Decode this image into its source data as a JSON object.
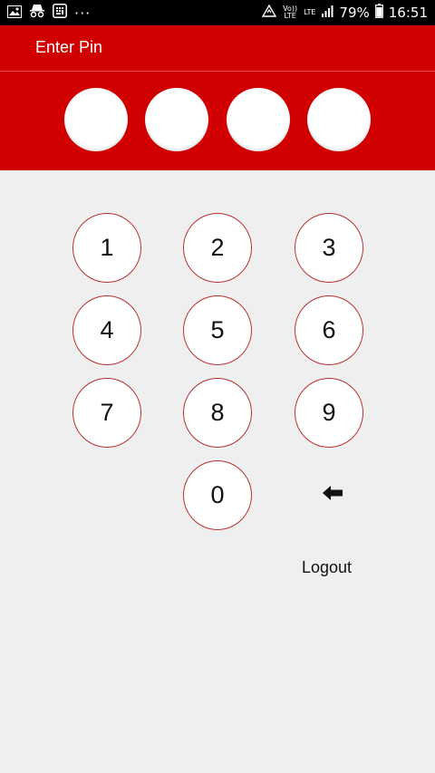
{
  "status_bar": {
    "battery_percent": "79%",
    "time": "16:51",
    "volte_label": "Vo)) LTE",
    "lte_label": "LTE",
    "more_label": "···"
  },
  "header": {
    "title": "Enter Pin"
  },
  "pin": {
    "entered_digits": 0,
    "total_digits": 4
  },
  "keypad": {
    "keys": [
      "1",
      "2",
      "3",
      "4",
      "5",
      "6",
      "7",
      "8",
      "9",
      "0"
    ]
  },
  "actions": {
    "logout_label": "Logout"
  },
  "colors": {
    "primary": "#d10000",
    "key_border": "#b83030",
    "background": "#efefef"
  }
}
